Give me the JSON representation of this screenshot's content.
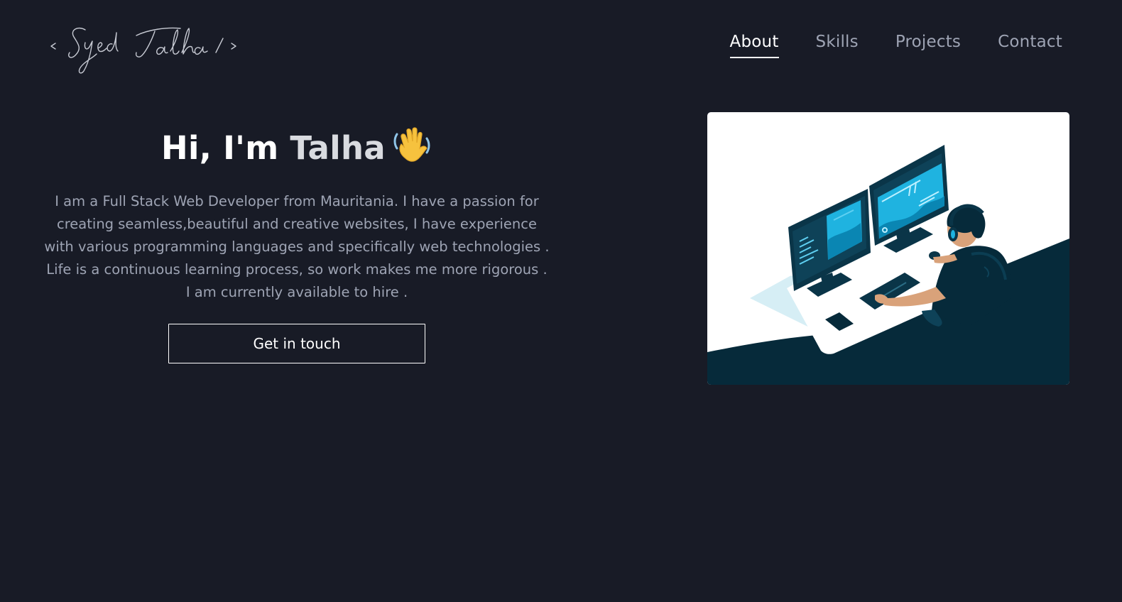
{
  "header": {
    "logo_text": "< Syed Talha / >",
    "nav": [
      {
        "label": "About",
        "active": true
      },
      {
        "label": "Skills",
        "active": false
      },
      {
        "label": "Projects",
        "active": false
      },
      {
        "label": "Contact",
        "active": false
      }
    ]
  },
  "hero": {
    "greeting": "Hi, I'm ",
    "name": "Talha",
    "emoji": "waving-hand-icon",
    "description": "I am a Full Stack Web Developer from Mauritania. I have a passion for creating seamless,beautiful and creative websites, I have experience with various programming languages and specifically web technologies . Life is a continuous learning process, so work makes me more rigorous . I am currently available to hire .",
    "cta_label": "Get in touch"
  },
  "colors": {
    "background": "#181b26",
    "text_primary": "#ffffff",
    "text_muted": "#9ea4b4",
    "illustration_dark": "#062a3a",
    "illustration_accent": "#1fb3e0"
  }
}
